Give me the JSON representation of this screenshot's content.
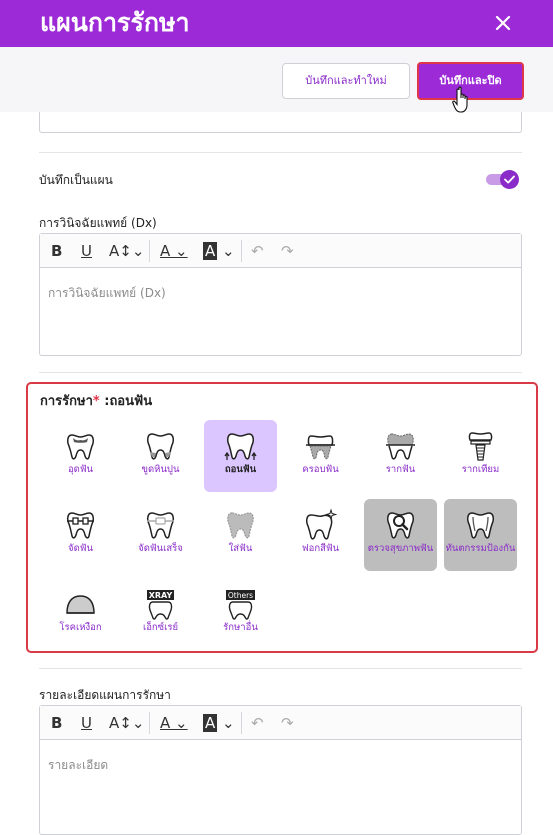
{
  "dialog": {
    "title": "แผนการรักษา",
    "close_icon": "close-icon"
  },
  "actions": {
    "save_new_label": "บันทึกและทำใหม่",
    "save_close_label": "บันทึกและปิด"
  },
  "save_as_plan": {
    "label": "บันทึกเป็นแผน",
    "enabled": true
  },
  "diagnosis": {
    "label": "การวินิจฉัยแพทย์ (Dx)",
    "placeholder": "การวินิจฉัยแพทย์ (Dx)"
  },
  "treatment": {
    "label": "การรักษา",
    "required_mark": "*",
    "selected_prefix": " :",
    "selected_value": "ถอนฟัน",
    "items": [
      {
        "label": "อุดฟัน",
        "icon": "tooth-filling-icon",
        "state": "normal"
      },
      {
        "label": "ขูดหินปูน",
        "icon": "tooth-scaling-icon",
        "state": "normal"
      },
      {
        "label": "ถอนฟัน",
        "icon": "tooth-extraction-icon",
        "state": "selected"
      },
      {
        "label": "ครอบฟัน",
        "icon": "tooth-crown-icon",
        "state": "normal"
      },
      {
        "label": "รากฟัน",
        "icon": "tooth-root-canal-icon",
        "state": "normal"
      },
      {
        "label": "รากเทียม",
        "icon": "tooth-implant-icon",
        "state": "normal"
      },
      {
        "label": "จัดฟัน",
        "icon": "tooth-braces-icon",
        "state": "normal"
      },
      {
        "label": "จัดฟันเสร็จ",
        "icon": "tooth-retainer-icon",
        "state": "normal"
      },
      {
        "label": "ใส่ฟัน",
        "icon": "tooth-denture-icon",
        "state": "normal"
      },
      {
        "label": "ฟอกสีฟัน",
        "icon": "tooth-whitening-icon",
        "state": "normal"
      },
      {
        "label": "ตรวจสุขภาพฟัน",
        "icon": "tooth-checkup-icon",
        "state": "disabled"
      },
      {
        "label": "ทันตกรรมป้องกัน",
        "icon": "tooth-prevention-icon",
        "state": "disabled"
      },
      {
        "label": "โรคเหงือก",
        "icon": "gum-disease-icon",
        "state": "normal"
      },
      {
        "label": "เอ็กซ์เรย์",
        "icon": "xray-icon",
        "state": "normal",
        "badge": "XRAY"
      },
      {
        "label": "รักษาอื่น",
        "icon": "others-icon",
        "state": "normal",
        "badge": "Others"
      }
    ]
  },
  "plan_detail": {
    "label": "รายละเอียดแผนการรักษา",
    "placeholder": "รายละเอียด"
  },
  "colors": {
    "brand": "#9c2ad6",
    "selected_tile": "#dcc6ff",
    "disabled_tile": "#bdbdbd",
    "required": "#e0364a"
  }
}
